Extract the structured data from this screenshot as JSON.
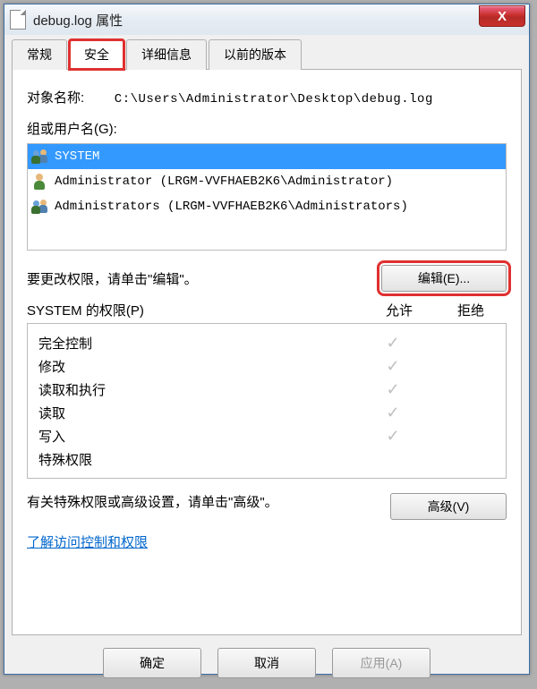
{
  "window": {
    "title": "debug.log 属性",
    "close": "X"
  },
  "tabs": [
    {
      "label": "常规",
      "active": false
    },
    {
      "label": "安全",
      "active": true
    },
    {
      "label": "详细信息",
      "active": false
    },
    {
      "label": "以前的版本",
      "active": false
    }
  ],
  "object_name_label": "对象名称:",
  "object_name_value": "C:\\Users\\Administrator\\Desktop\\debug.log",
  "group_users_label": "组或用户名(G):",
  "principals": [
    {
      "name": "SYSTEM",
      "icon": "group",
      "selected": true
    },
    {
      "name": "Administrator (LRGM-VVFHAEB2K6\\Administrator)",
      "icon": "single",
      "selected": false
    },
    {
      "name": "Administrators (LRGM-VVFHAEB2K6\\Administrators)",
      "icon": "group",
      "selected": false
    }
  ],
  "edit_hint": "要更改权限，请单击\"编辑\"。",
  "edit_button": "编辑(E)...",
  "perm_header_label": "SYSTEM 的权限(P)",
  "perm_col_allow": "允许",
  "perm_col_deny": "拒绝",
  "permissions": [
    {
      "name": "完全控制",
      "allow": true,
      "deny": false
    },
    {
      "name": "修改",
      "allow": true,
      "deny": false
    },
    {
      "name": "读取和执行",
      "allow": true,
      "deny": false
    },
    {
      "name": "读取",
      "allow": true,
      "deny": false
    },
    {
      "name": "写入",
      "allow": true,
      "deny": false
    },
    {
      "name": "特殊权限",
      "allow": false,
      "deny": false
    }
  ],
  "adv_hint": "有关特殊权限或高级设置，请单击\"高级\"。",
  "adv_button": "高级(V)",
  "help_link": "了解访问控制和权限",
  "buttons": {
    "ok": "确定",
    "cancel": "取消",
    "apply": "应用(A)"
  }
}
